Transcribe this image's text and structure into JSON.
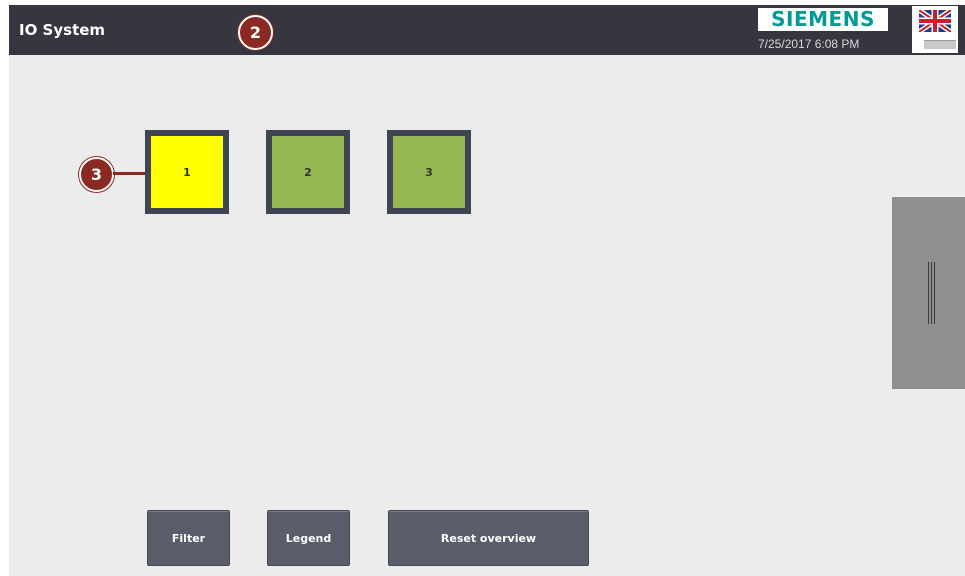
{
  "header": {
    "title": "IO System",
    "brand": "SIEMENS",
    "datetime": "7/25/2017 6:08 PM",
    "language_icon": "uk-flag-icon"
  },
  "callouts": [
    "2",
    "3"
  ],
  "devices": [
    {
      "label": "1",
      "status": "yellow"
    },
    {
      "label": "2",
      "status": "green"
    },
    {
      "label": "3",
      "status": "green"
    }
  ],
  "side_panel": {
    "icon": "grip-handle-icon"
  },
  "footer": {
    "filter_label": "Filter",
    "legend_label": "Legend",
    "reset_label": "Reset overview"
  },
  "colors": {
    "header_bg": "#35363f",
    "screen_bg": "#ececec",
    "brand": "#009999",
    "callout": "#8b2a22",
    "device_warning": "#ffff00",
    "device_ok": "#96b850",
    "button_bg": "#5a5e6b"
  }
}
